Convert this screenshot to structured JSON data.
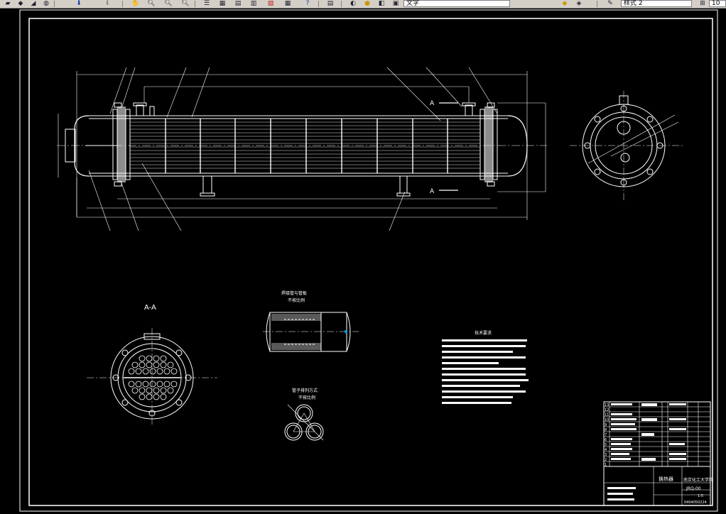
{
  "toolbar": {
    "icons": [
      "layer-icon",
      "arrow-down-icon",
      "arrow-icon",
      "zoom-icon",
      "zoom-in-icon",
      "zoom-out-icon",
      "zoom-realtime-icon",
      "properties-icon",
      "design-center-icon",
      "tool-palette-icon",
      "sheet-set-icon",
      "markup-icon",
      "calculator-icon",
      "help-icon",
      "style-icon",
      "text-style-icon",
      "dim-style-icon",
      "layer-state-icon",
      "layer-props-icon",
      "linetype-icon"
    ],
    "text_style_label": "文字",
    "linetype_value": "样式 2",
    "partial_value": "10"
  },
  "drawing": {
    "section_label": "A-A",
    "section_arrow_top": "A",
    "section_arrow_bottom": "A",
    "detail1_title": "焊接管与管板",
    "detail1_subtitle": "不按比例",
    "detail2_title": "管子排列方式",
    "detail2_subtitle": "不按比例",
    "tech_req_title": "技术要求",
    "title_block": {
      "drawing_name": "换热器",
      "school": "南京化工大学院",
      "drawing_no": "JRQ-00",
      "scale": "1:5",
      "sheet": "0404050224"
    },
    "parts_numbers": [
      "13",
      "12",
      "11",
      "10",
      "9",
      "8",
      "7",
      "6",
      "5",
      "4",
      "3",
      "2",
      "1"
    ]
  }
}
